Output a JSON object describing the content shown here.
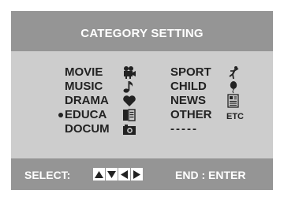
{
  "title": "CATEGORY SETTING",
  "categories_left": [
    {
      "label": "MOVIE",
      "icon": "movie-camera-icon"
    },
    {
      "label": "MUSIC",
      "icon": "music-note-icon"
    },
    {
      "label": "DRAMA",
      "icon": "heart-icon"
    },
    {
      "label": "EDUCA",
      "icon": "book-icon",
      "selected": true
    },
    {
      "label": "DOCUM",
      "icon": "camera-icon"
    }
  ],
  "categories_right": [
    {
      "label": "SPORT",
      "icon": "sport-player-icon"
    },
    {
      "label": "CHILD",
      "icon": "child-balloon-icon"
    },
    {
      "label": "NEWS",
      "icon": "newspaper-icon"
    },
    {
      "label": "OTHER",
      "icon": "etc-icon",
      "icon_text": "ETC"
    },
    {
      "label": "-----"
    }
  ],
  "footer": {
    "select_label": "SELECT:",
    "end_label": "END : ENTER",
    "keys": [
      "up-arrow-key",
      "down-arrow-key",
      "left-arrow-key",
      "right-arrow-key"
    ]
  },
  "colors": {
    "screen_bg": "#cdcdcd",
    "band_bg": "#959595",
    "item_text": "#222222",
    "band_text": "#ffffff"
  }
}
